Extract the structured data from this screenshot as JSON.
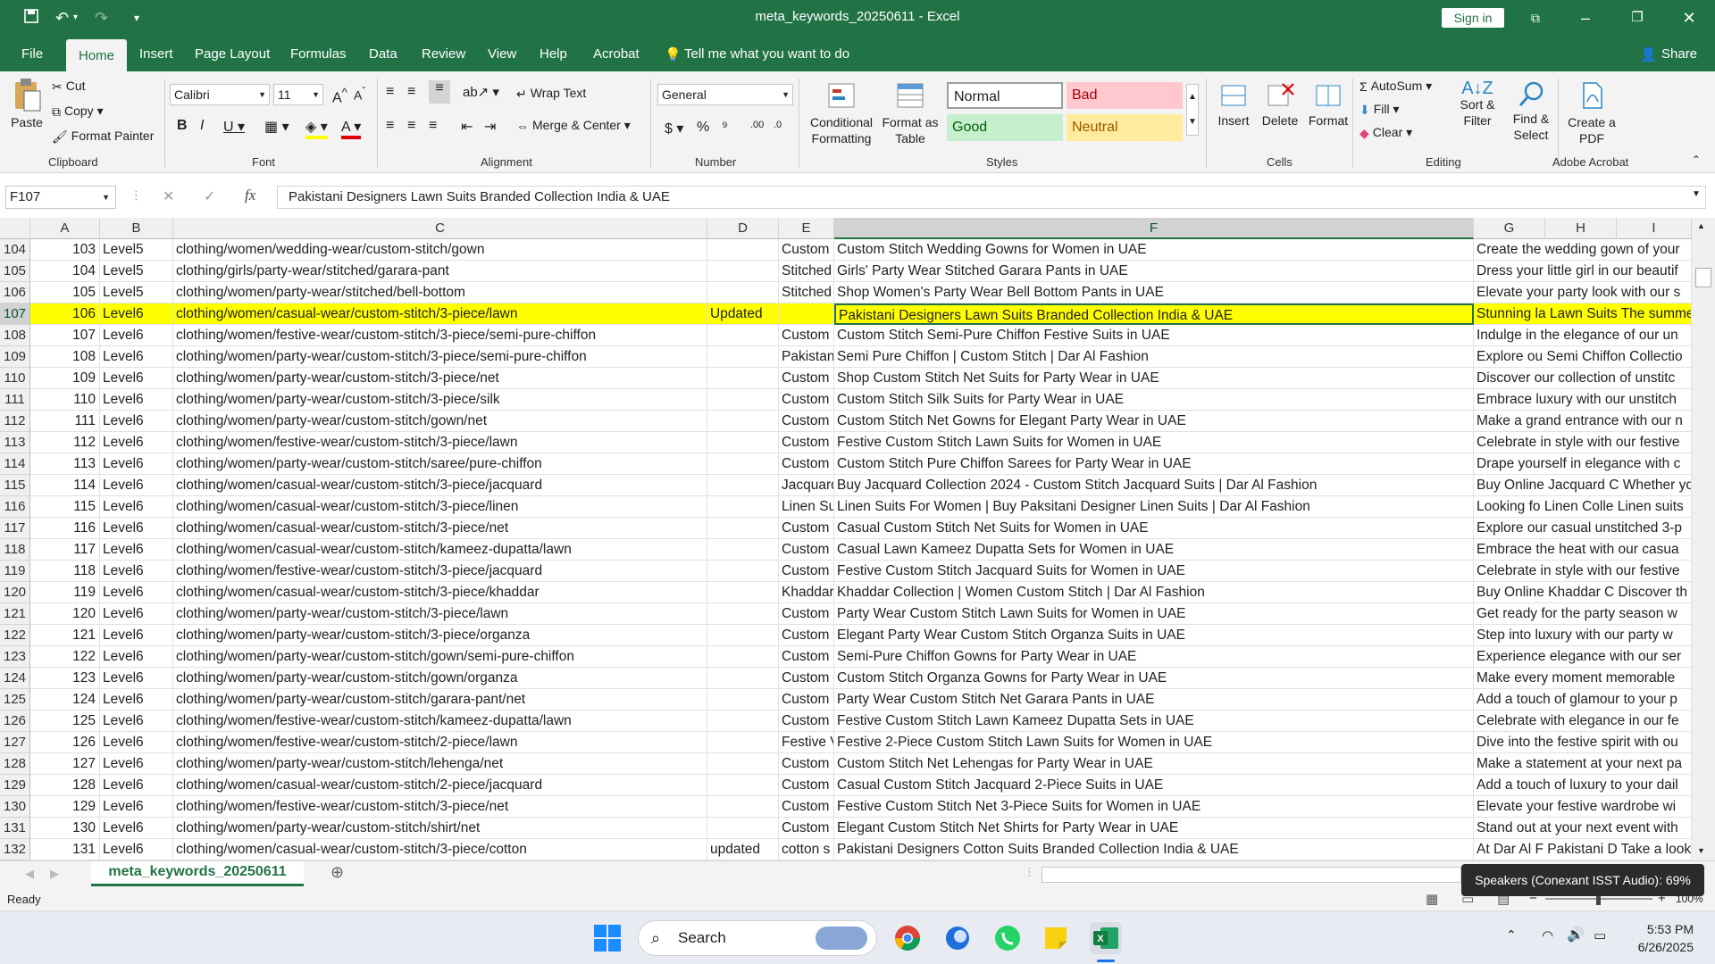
{
  "window": {
    "title": "meta_keywords_20250611  -  Excel",
    "sign_in": "Sign in",
    "share": "Share"
  },
  "ribbon_tabs": [
    "File",
    "Home",
    "Insert",
    "Page Layout",
    "Formulas",
    "Data",
    "Review",
    "View",
    "Help",
    "Acrobat"
  ],
  "tell_me": "Tell me what you want to do",
  "clipboard": {
    "paste": "Paste",
    "cut": "Cut",
    "copy": "Copy",
    "format_painter": "Format Painter",
    "label": "Clipboard"
  },
  "font": {
    "name": "Calibri",
    "size": "11",
    "label": "Font"
  },
  "alignment": {
    "wrap": "Wrap Text",
    "merge": "Merge & Center",
    "label": "Alignment"
  },
  "number": {
    "format": "General",
    "label": "Number"
  },
  "styles": {
    "conditional": "Conditional Formatting",
    "format_table": "Format as Table",
    "normal": "Normal",
    "bad": "Bad",
    "good": "Good",
    "neutral": "Neutral",
    "label": "Styles"
  },
  "cells": {
    "insert": "Insert",
    "delete": "Delete",
    "format": "Format",
    "label": "Cells"
  },
  "editing": {
    "autosum": "AutoSum",
    "fill": "Fill",
    "clear": "Clear",
    "sort": "Sort & Filter",
    "find": "Find & Select",
    "label": "Editing"
  },
  "acrobat": {
    "create": "Create a PDF",
    "label": "Adobe Acrobat"
  },
  "formula_bar": {
    "name_box": "F107",
    "content": "Pakistani Designers Lawn Suits Branded Collection India & UAE"
  },
  "columns": [
    "A",
    "B",
    "C",
    "D",
    "E",
    "F",
    "G",
    "H",
    "I"
  ],
  "rows": [
    {
      "r": "104",
      "a": "103",
      "b": "Level5",
      "c": "clothing/women/wedding-wear/custom-stitch/gown",
      "d": "",
      "e": "Custom",
      "f": "Custom Stitch Wedding Gowns for Women in UAE",
      "g": "Create the wedding gown of your"
    },
    {
      "r": "105",
      "a": "104",
      "b": "Level5",
      "c": "clothing/girls/party-wear/stitched/garara-pant",
      "d": "",
      "e": "Stitched",
      "f": "Girls' Party Wear Stitched Garara Pants in UAE",
      "g": "Dress your little girl in our beautif"
    },
    {
      "r": "106",
      "a": "105",
      "b": "Level5",
      "c": "clothing/women/party-wear/stitched/bell-bottom",
      "d": "",
      "e": "Stitched",
      "f": "Shop Women's Party Wear Bell Bottom Pants in UAE",
      "g": "Elevate your party look with our s"
    },
    {
      "r": "107",
      "a": "106",
      "b": "Level6",
      "c": "clothing/women/casual-wear/custom-stitch/3-piece/lawn",
      "d": "Updated",
      "e": "",
      "f": "Pakistani Designers Lawn Suits Branded Collection India & UAE",
      "g": "Stunning la Lawn Suits The summe"
    },
    {
      "r": "108",
      "a": "107",
      "b": "Level6",
      "c": "clothing/women/festive-wear/custom-stitch/3-piece/semi-pure-chiffon",
      "d": "",
      "e": "Custom",
      "f": "Custom Stitch Semi-Pure Chiffon Festive Suits in UAE",
      "g": "Indulge in the elegance of our un"
    },
    {
      "r": "109",
      "a": "108",
      "b": "Level6",
      "c": "clothing/women/party-wear/custom-stitch/3-piece/semi-pure-chiffon",
      "d": "",
      "e": "Pakistan",
      "f": "Semi Pure Chiffon | Custom Stitch | Dar Al Fashion",
      "g": "Explore ou Semi Chiffon Collectio"
    },
    {
      "r": "110",
      "a": "109",
      "b": "Level6",
      "c": "clothing/women/party-wear/custom-stitch/3-piece/net",
      "d": "",
      "e": "Custom",
      "f": "Shop Custom Stitch Net Suits for Party Wear in UAE",
      "g": "Discover our collection of unstitc"
    },
    {
      "r": "111",
      "a": "110",
      "b": "Level6",
      "c": "clothing/women/party-wear/custom-stitch/3-piece/silk",
      "d": "",
      "e": "Custom",
      "f": "Custom Stitch Silk Suits for Party Wear in UAE",
      "g": "Embrace luxury with our unstitch"
    },
    {
      "r": "112",
      "a": "111",
      "b": "Level6",
      "c": "clothing/women/party-wear/custom-stitch/gown/net",
      "d": "",
      "e": "Custom",
      "f": "Custom Stitch Net Gowns for Elegant Party Wear in UAE",
      "g": "Make a grand entrance with our n"
    },
    {
      "r": "113",
      "a": "112",
      "b": "Level6",
      "c": "clothing/women/festive-wear/custom-stitch/3-piece/lawn",
      "d": "",
      "e": "Custom",
      "f": "Festive Custom Stitch Lawn Suits for Women in UAE",
      "g": "Celebrate in style with our festive"
    },
    {
      "r": "114",
      "a": "113",
      "b": "Level6",
      "c": "clothing/women/party-wear/custom-stitch/saree/pure-chiffon",
      "d": "",
      "e": "Custom",
      "f": "Custom Stitch Pure Chiffon Sarees for Party Wear in UAE",
      "g": "Drape yourself in elegance with c"
    },
    {
      "r": "115",
      "a": "114",
      "b": "Level6",
      "c": "clothing/women/casual-wear/custom-stitch/3-piece/jacquard",
      "d": "",
      "e": "Jacquard",
      "f": "Buy Jacquard Collection 2024 - Custom Stitch Jacquard Suits | Dar Al Fashion",
      "g": "Buy Online Jacquard C Whether yo"
    },
    {
      "r": "116",
      "a": "115",
      "b": "Level6",
      "c": "clothing/women/casual-wear/custom-stitch/3-piece/linen",
      "d": "",
      "e": "Linen Su",
      "f": "Linen Suits For Women   |  Buy Paksitani Designer Linen Suits | Dar Al Fashion",
      "g": "Looking fo Linen Colle Linen suits"
    },
    {
      "r": "117",
      "a": "116",
      "b": "Level6",
      "c": "clothing/women/casual-wear/custom-stitch/3-piece/net",
      "d": "",
      "e": "Custom",
      "f": "Casual Custom Stitch Net Suits for Women in UAE",
      "g": "Explore our casual unstitched 3-p"
    },
    {
      "r": "118",
      "a": "117",
      "b": "Level6",
      "c": "clothing/women/casual-wear/custom-stitch/kameez-dupatta/lawn",
      "d": "",
      "e": "Custom",
      "f": "Casual Lawn Kameez Dupatta Sets for Women in UAE",
      "g": "Embrace the heat with our casua"
    },
    {
      "r": "119",
      "a": "118",
      "b": "Level6",
      "c": "clothing/women/festive-wear/custom-stitch/3-piece/jacquard",
      "d": "",
      "e": "Custom",
      "f": "Festive Custom Stitch Jacquard Suits for Women in UAE",
      "g": "Celebrate in style with our festive"
    },
    {
      "r": "120",
      "a": "119",
      "b": "Level6",
      "c": "clothing/women/casual-wear/custom-stitch/3-piece/khaddar",
      "d": "",
      "e": "Khaddar",
      "f": "Khaddar Collection | Women Custom Stitch | Dar Al Fashion",
      "g": "Buy Online Khaddar C Discover th"
    },
    {
      "r": "121",
      "a": "120",
      "b": "Level6",
      "c": "clothing/women/party-wear/custom-stitch/3-piece/lawn",
      "d": "",
      "e": "Custom",
      "f": "Party Wear Custom Stitch Lawn Suits for Women in UAE",
      "g": "Get ready for the party season w"
    },
    {
      "r": "122",
      "a": "121",
      "b": "Level6",
      "c": "clothing/women/party-wear/custom-stitch/3-piece/organza",
      "d": "",
      "e": "Custom",
      "f": "Elegant Party Wear Custom Stitch Organza Suits in UAE",
      "g": "Step into luxury with our party w"
    },
    {
      "r": "123",
      "a": "122",
      "b": "Level6",
      "c": "clothing/women/party-wear/custom-stitch/gown/semi-pure-chiffon",
      "d": "",
      "e": "Custom",
      "f": "Semi-Pure Chiffon Gowns for Party Wear in UAE",
      "g": "Experience elegance with our ser"
    },
    {
      "r": "124",
      "a": "123",
      "b": "Level6",
      "c": "clothing/women/party-wear/custom-stitch/gown/organza",
      "d": "",
      "e": "Custom",
      "f": "Custom Stitch Organza Gowns for Party Wear in UAE",
      "g": "Make every moment memorable"
    },
    {
      "r": "125",
      "a": "124",
      "b": "Level6",
      "c": "clothing/women/party-wear/custom-stitch/garara-pant/net",
      "d": "",
      "e": "Custom",
      "f": "Party Wear Custom Stitch Net Garara Pants in UAE",
      "g": "Add a touch of glamour to your p"
    },
    {
      "r": "126",
      "a": "125",
      "b": "Level6",
      "c": "clothing/women/festive-wear/custom-stitch/kameez-dupatta/lawn",
      "d": "",
      "e": "Custom",
      "f": "Festive Custom Stitch Lawn Kameez Dupatta Sets in UAE",
      "g": "Celebrate with elegance in our fe"
    },
    {
      "r": "127",
      "a": "126",
      "b": "Level6",
      "c": "clothing/women/festive-wear/custom-stitch/2-piece/lawn",
      "d": "",
      "e": "Festive V",
      "f": "Festive 2-Piece Custom Stitch Lawn Suits for Women in UAE",
      "g": "Dive into the festive spirit with ou"
    },
    {
      "r": "128",
      "a": "127",
      "b": "Level6",
      "c": "clothing/women/party-wear/custom-stitch/lehenga/net",
      "d": "",
      "e": "Custom",
      "f": "Custom Stitch Net Lehengas for Party Wear in UAE",
      "g": "Make a statement at your next pa"
    },
    {
      "r": "129",
      "a": "128",
      "b": "Level6",
      "c": "clothing/women/casual-wear/custom-stitch/2-piece/jacquard",
      "d": "",
      "e": "Custom",
      "f": "Casual Custom Stitch Jacquard 2-Piece Suits in UAE",
      "g": "Add a touch of luxury to your dail"
    },
    {
      "r": "130",
      "a": "129",
      "b": "Level6",
      "c": "clothing/women/festive-wear/custom-stitch/3-piece/net",
      "d": "",
      "e": "Custom",
      "f": "Festive Custom Stitch Net 3-Piece Suits for Women in UAE",
      "g": "Elevate your festive wardrobe wi"
    },
    {
      "r": "131",
      "a": "130",
      "b": "Level6",
      "c": "clothing/women/party-wear/custom-stitch/shirt/net",
      "d": "",
      "e": "Custom",
      "f": "Elegant Custom Stitch Net Shirts for Party Wear in UAE",
      "g": "Stand out at your next event with"
    },
    {
      "r": "132",
      "a": "131",
      "b": "Level6",
      "c": "clothing/women/casual-wear/custom-stitch/3-piece/cotton",
      "d": "updated",
      "e": "cotton s",
      "f": "Pakistani Designers Cotton Suits Branded Collection India & UAE",
      "g": "At Dar Al F Pakistani D Take a look"
    }
  ],
  "sheet_tab": "meta_keywords_20250611",
  "status": "Ready",
  "zoom": "100%",
  "tooltip": "Speakers (Conexant ISST Audio): 69%",
  "taskbar": {
    "search": "Search",
    "time": "5:53 PM",
    "date": "6/26/2025"
  },
  "colors": {
    "accent": "#217346",
    "highlight": "#ffff00"
  }
}
